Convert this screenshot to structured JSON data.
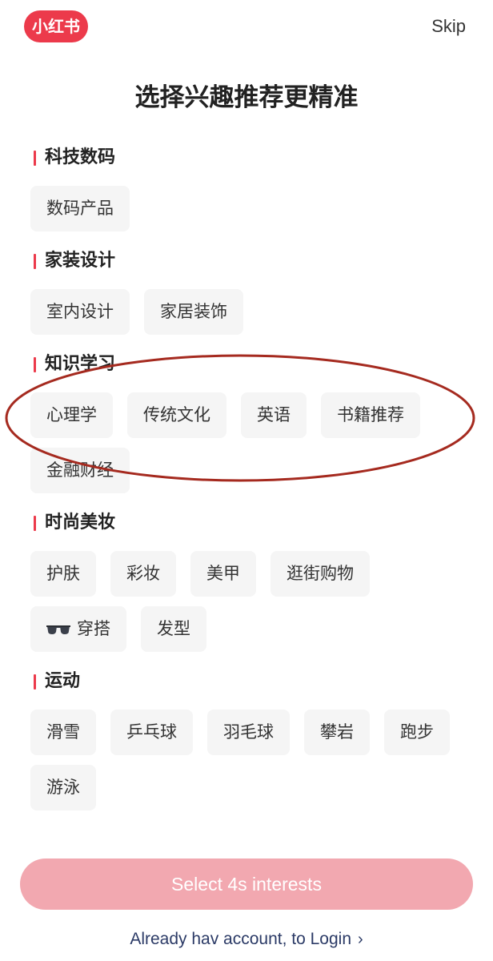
{
  "header": {
    "logo_text": "小红书",
    "skip_label": "Skip",
    "title": "选择兴趣推荐更精准"
  },
  "sections": [
    {
      "title": "科技数码",
      "tags": [
        "数码产品"
      ]
    },
    {
      "title": "家装设计",
      "tags": [
        "室内设计",
        "家居装饰"
      ]
    },
    {
      "title": "知识学习",
      "tags": [
        "心理学",
        "传统文化",
        "英语",
        "书籍推荐",
        "金融财经"
      ]
    },
    {
      "title": "时尚美妆",
      "tags": [
        "护肤",
        "彩妆",
        "美甲",
        "逛街购物",
        "穿搭",
        "发型"
      ]
    },
    {
      "title": "运动",
      "tags": [
        "滑雪",
        "乒乓球",
        "羽毛球",
        "攀岩",
        "跑步",
        "游泳"
      ]
    }
  ],
  "annotation": {
    "color": "#a52a1f",
    "shape": "ellipse"
  },
  "footer": {
    "button_label": "Select 4s interests",
    "login_label": "Already hav account, to Login",
    "login_chevron": "›"
  },
  "colors": {
    "brand": "#ec3a4b",
    "button_disabled": "#f2a8b0",
    "tag_bg": "#f5f5f5",
    "link": "#2b3a66"
  },
  "icons": {
    "sunglasses": "sunglasses-icon",
    "chevron": "chevron-right-icon"
  }
}
